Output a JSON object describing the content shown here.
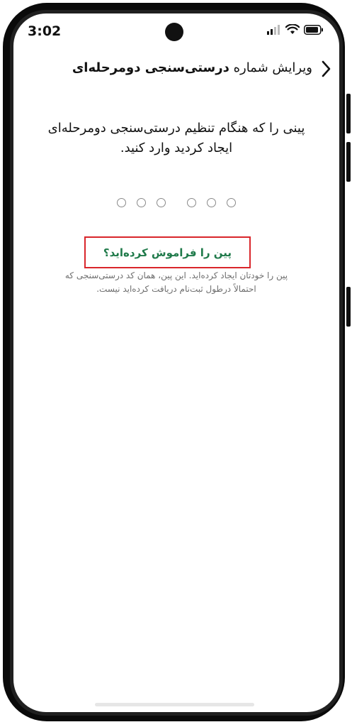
{
  "status_bar": {
    "time": "3:02",
    "icons": [
      "cellular-signal-icon",
      "wifi-icon",
      "battery-icon"
    ]
  },
  "header": {
    "back_icon": "chevron-right-icon",
    "title_prefix": "ویرایش شماره",
    "title_bold": "درستی‌سنجی دومرحله‌ای"
  },
  "instruction": {
    "line1": "پینی را که هنگام تنظیم درستی‌سنجی دومرحله‌ای",
    "line2": "ایجاد کردید وارد کنید."
  },
  "pin": {
    "length": 6,
    "filled": 0
  },
  "forgot": {
    "label": "پین را فراموش کرده‌اید؟"
  },
  "helper": {
    "line1": "پین را خودتان ایجاد کرده‌اید. این پین، همان کد درستی‌سنجی که",
    "line2": "احتمالاً درطول ثبت‌نام دریافت کرده‌اید نیست."
  },
  "colors": {
    "link": "#1f7a4a",
    "highlight_border": "#d9262b",
    "pin_dot_border": "#8a8a8a"
  }
}
